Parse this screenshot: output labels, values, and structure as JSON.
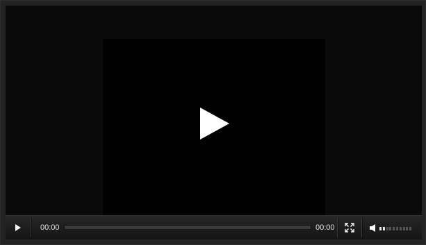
{
  "player": {
    "current_time": "00:00",
    "duration": "00:00",
    "progress": 0,
    "volume_level": 0.2,
    "volume_segments": 10
  },
  "colors": {
    "background": "#232323",
    "video": "#000000",
    "icon": "#ffffff",
    "text": "#e6e6e6"
  },
  "icons": {
    "big_play": "play-icon",
    "play": "play-icon",
    "fullscreen": "fullscreen-icon",
    "volume": "speaker-icon"
  }
}
